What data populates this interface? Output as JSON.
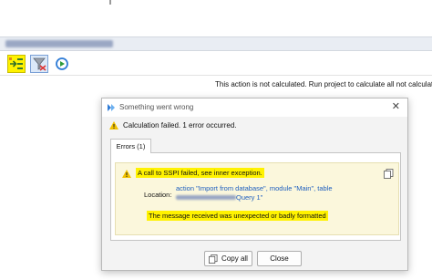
{
  "status_message": "This action is not calculated. Run project to calculate all not calculate",
  "toolbar": {
    "buttons": [
      {
        "icon": "calculate-icon"
      },
      {
        "icon": "filter-icon"
      },
      {
        "icon": "run-icon"
      }
    ]
  },
  "dialog": {
    "title": "Something went wrong",
    "summary": "Calculation failed. 1 error occurred.",
    "tab_label": "Errors (1)",
    "error": {
      "title": "A call to SSPI failed, see inner exception.",
      "location_label": "Location:",
      "location_line1": "action \"Import from database\", module \"Main\", table",
      "location_line2": "Query 1\"",
      "message": "The message received was unexpected or badly formatted"
    },
    "copy_all_label": "Copy all",
    "close_label": "Close"
  },
  "colors": {
    "highlight": "#fff200",
    "link": "#1f5fbf",
    "warning": "#f2c200"
  }
}
